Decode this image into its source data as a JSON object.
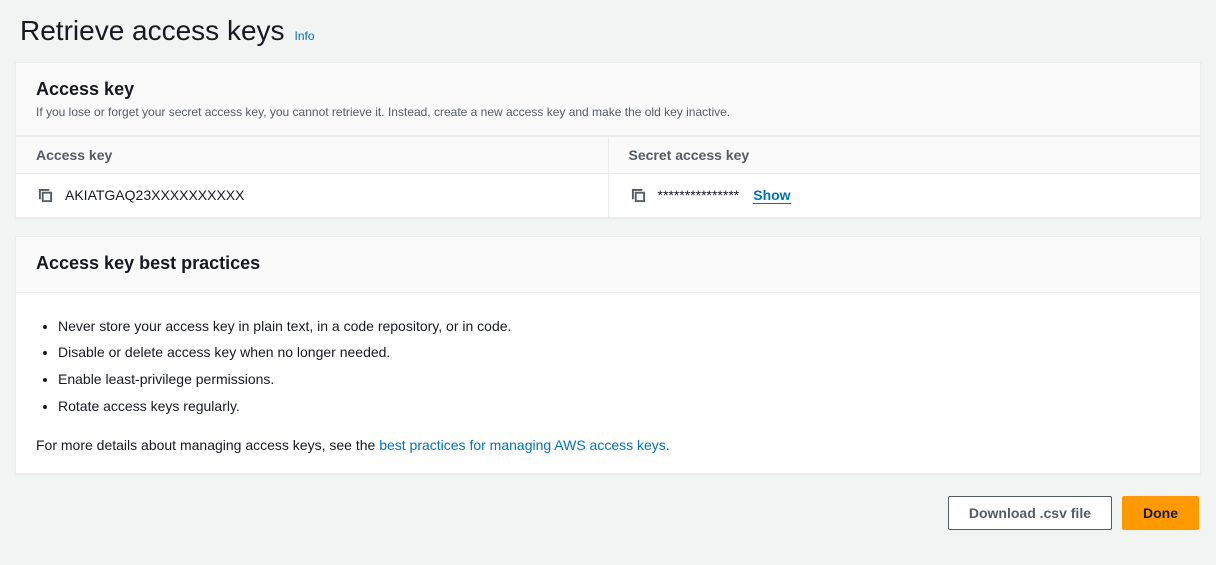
{
  "header": {
    "title": "Retrieve access keys",
    "info": "Info"
  },
  "accessKeyPanel": {
    "title": "Access key",
    "description": "If you lose or forget your secret access key, you cannot retrieve it. Instead, create a new access key and make the old key inactive.",
    "accessKeyLabel": "Access key",
    "accessKeyValue": "AKIATGAQ23XXXXXXXXXX",
    "secretLabel": "Secret access key",
    "secretMasked": "***************",
    "showLabel": "Show"
  },
  "practicesPanel": {
    "title": "Access key best practices",
    "items": [
      "Never store your access key in plain text, in a code repository, or in code.",
      "Disable or delete access key when no longer needed.",
      "Enable least-privilege permissions.",
      "Rotate access keys regularly."
    ],
    "moreTextPrefix": "For more details about managing access keys, see the ",
    "moreLinkText": "best practices for managing AWS access keys",
    "moreTextSuffix": "."
  },
  "actions": {
    "download": "Download .csv file",
    "done": "Done"
  }
}
